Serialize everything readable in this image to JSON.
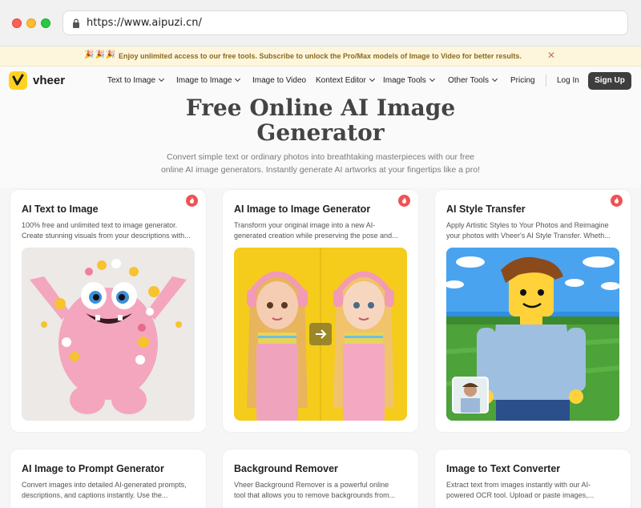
{
  "browser": {
    "url": "https://www.aipuzi.cn/"
  },
  "announcement": {
    "emoji": "🎉🎉🎉",
    "text": "Enjoy unlimited access to our free tools. Subscribe to unlock the Pro/Max models of Image to Video for better results.",
    "close": "✕"
  },
  "nav": {
    "logo": "vheer",
    "items": [
      {
        "label": "Text to Image"
      },
      {
        "label": "Image to Image"
      },
      {
        "label": "Image to Video"
      },
      {
        "label": "Kontext Editor"
      },
      {
        "label": "Image Tools"
      },
      {
        "label": "Other Tools"
      },
      {
        "label": "Pricing"
      }
    ],
    "login": "Log In",
    "signup": "Sign Up"
  },
  "hero": {
    "title_line1": "Free Online AI Image",
    "title_line2": "Generator",
    "subtitle_line1": "Convert simple text or ordinary photos into breathtaking masterpieces with our free",
    "subtitle_line2": "online AI image generators. Instantly generate AI artworks at your fingertips like a pro!"
  },
  "cards": [
    {
      "title": "AI Text to Image",
      "desc_line1": "100% free and unlimited text to image generator.",
      "desc_line2": "Create stunning visuals from your descriptions with..."
    },
    {
      "title": "AI Image to Image Generator",
      "desc_line1": "Transform your original image into a new AI-",
      "desc_line2": "generated creation while preserving the pose and..."
    },
    {
      "title": "AI Style Transfer",
      "desc_line1": "Apply Artistic Styles to Your Photos and Reimagine",
      "desc_line2": "your photos with Vheer's AI Style Transfer. Wheth..."
    },
    {
      "title": "AI Image to Prompt Generator",
      "desc_line1": "Convert images into detailed AI-generated prompts,",
      "desc_line2": "descriptions, and captions instantly. Use the..."
    },
    {
      "title": "Background Remover",
      "desc_line1": "Vheer Background Remover is a powerful online",
      "desc_line2": "tool that allows you to remove backgrounds from..."
    },
    {
      "title": "Image to Text Converter",
      "desc_line1": "Extract text from images instantly with our AI-",
      "desc_line2": "powered OCR tool. Upload or paste images,..."
    }
  ],
  "colors": {
    "accent_yellow": "#ffd21f",
    "hot_badge": "#f05252",
    "signup_bg": "#3e3e3e"
  },
  "icons": {
    "hot": "fire-icon",
    "lock": "lock-icon",
    "arrow": "arrow-right-icon"
  }
}
